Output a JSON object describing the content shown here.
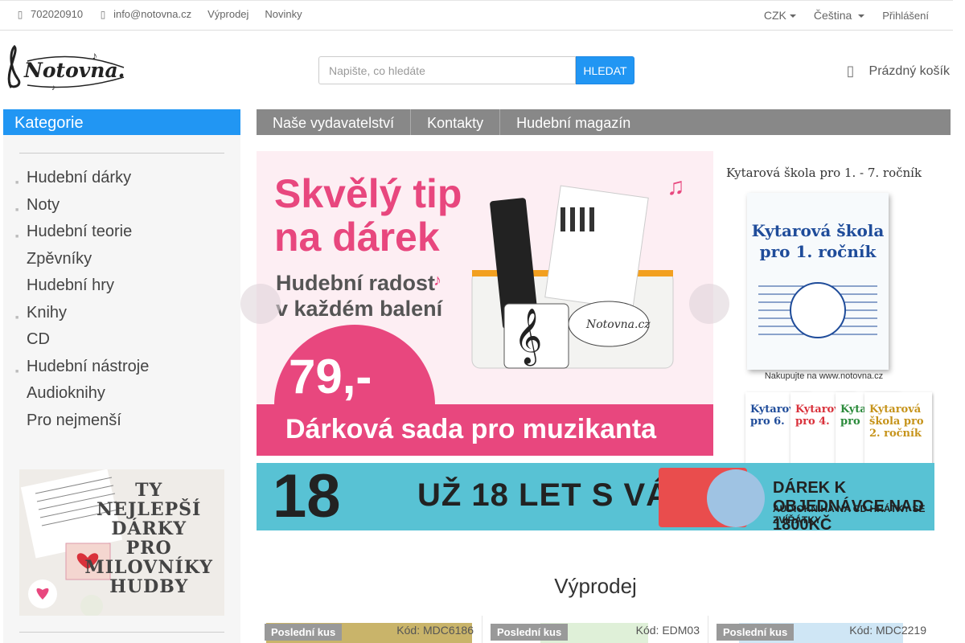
{
  "topbar": {
    "phone": "702020910",
    "email": "info@notovna.cz",
    "links": [
      "Výprodej",
      "Novinky"
    ],
    "currency": "CZK",
    "language": "Čeština",
    "login": "Přihlášení"
  },
  "header": {
    "logo_text": "Notovna.cz",
    "search_placeholder": "Napište, co hledáte",
    "search_button": "HLEDAT",
    "cart_label": "Prázdný košík"
  },
  "sidebar": {
    "heading": "Kategorie",
    "items": [
      {
        "label": "Hudební dárky",
        "has_sub": true
      },
      {
        "label": "Noty",
        "has_sub": true
      },
      {
        "label": "Hudební teorie",
        "has_sub": true
      },
      {
        "label": "Zpěvníky",
        "has_sub": false
      },
      {
        "label": "Hudební hry",
        "has_sub": false
      },
      {
        "label": "Knihy",
        "has_sub": true
      },
      {
        "label": "CD",
        "has_sub": false
      },
      {
        "label": "Hudební nástroje",
        "has_sub": true
      },
      {
        "label": "Audioknihy",
        "has_sub": false
      },
      {
        "label": "Pro nejmenší",
        "has_sub": false
      }
    ],
    "promo_text": "TY\nNEJLEPŠÍ\nDÁRKY\nPRO\nMILOVNÍKY\nHUDBY"
  },
  "nav": [
    "Naše vydavatelství",
    "Kontakty",
    "Hudební magazín"
  ],
  "banner_main": {
    "headline_1": "Skvělý tip",
    "headline_2": "na dárek",
    "sub_1": "Hudební radost",
    "sub_2": "v každém balení",
    "price": "79,-",
    "strip": "Dárková sada pro muzikanta",
    "pouch_logo": "Notovna.cz"
  },
  "banner_side": {
    "title": "Kytarová škola pro 1. - 7. ročník",
    "book_title": "Kytarová škola pro 1. ročník",
    "shop": "Nakupujte na www.notovna.cz",
    "mini_books": [
      "Kytarová pro 6.",
      "Kytarová pro 4.",
      "Kytarová pro 3.",
      "Kytarová škola pro 2. ročník"
    ]
  },
  "banner_anniv": {
    "number": "18",
    "text": "UŽ 18 LET S VÁMI",
    "gift_1": "DÁREK K OBJEDNÁVCE NAD 1800KČ",
    "gift_2": "AUDIOKNIHA NA CD HRÁTKY SE ZVÍŘÁTKY"
  },
  "sale": {
    "title": "Výprodej",
    "products": [
      {
        "badge": "Poslední kus",
        "code": "Kód: MDC6186"
      },
      {
        "badge": "Poslední kus",
        "code": "Kód: EDM03"
      },
      {
        "badge": "Poslední kus",
        "code": "Kód: MDC2219"
      }
    ]
  },
  "colors": {
    "accent": "#2196f3",
    "nav_bg": "#888888",
    "pink": "#e8477e",
    "teal": "#58c2d4"
  }
}
